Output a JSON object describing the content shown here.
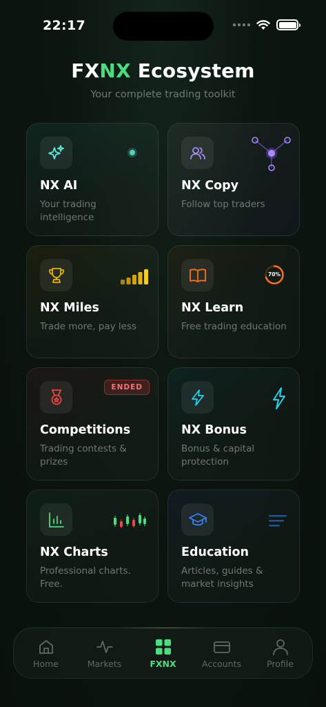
{
  "status_bar": {
    "time": "22:17"
  },
  "header": {
    "title_part1": "FX",
    "title_part2": "NX",
    "title_part3": " Ecosystem",
    "subtitle": "Your complete trading toolkit"
  },
  "cards": [
    {
      "title": "NX AI",
      "desc": "Your trading intelligence",
      "icon": "sparkles-icon",
      "color": "#5eead4"
    },
    {
      "title": "NX Copy",
      "desc": "Follow top traders",
      "icon": "users-icon",
      "color": "#a78bfa"
    },
    {
      "title": "NX Miles",
      "desc": "Trade more, pay less",
      "icon": "trophy-icon",
      "color": "#eab308"
    },
    {
      "title": "NX Learn",
      "desc": "Free trading education",
      "icon": "book-icon",
      "color": "#f97316",
      "progress_label": "70%",
      "progress": 0.7
    },
    {
      "title": "Competitions",
      "desc": "Trading contests & prizes",
      "icon": "medal-icon",
      "color": "#ef4444",
      "badge": "ENDED"
    },
    {
      "title": "NX Bonus",
      "desc": "Bonus & capital protection",
      "icon": "lightning-icon",
      "color": "#22d3ee"
    },
    {
      "title": "NX Charts",
      "desc": "Professional charts. Free.",
      "icon": "bar-chart-icon",
      "color": "#4ade80"
    },
    {
      "title": "Education",
      "desc": "Articles, guides & market insights",
      "icon": "graduation-cap-icon",
      "color": "#3b82f6"
    }
  ],
  "tabs": [
    {
      "label": "Home",
      "icon": "home-icon"
    },
    {
      "label": "Markets",
      "icon": "activity-icon"
    },
    {
      "label": "FXNX",
      "icon": "grid-icon",
      "active": true
    },
    {
      "label": "Accounts",
      "icon": "card-icon"
    },
    {
      "label": "Profile",
      "icon": "user-icon"
    }
  ],
  "colors": {
    "accent": "#4ade80",
    "muted_text": "#6f7a74"
  }
}
